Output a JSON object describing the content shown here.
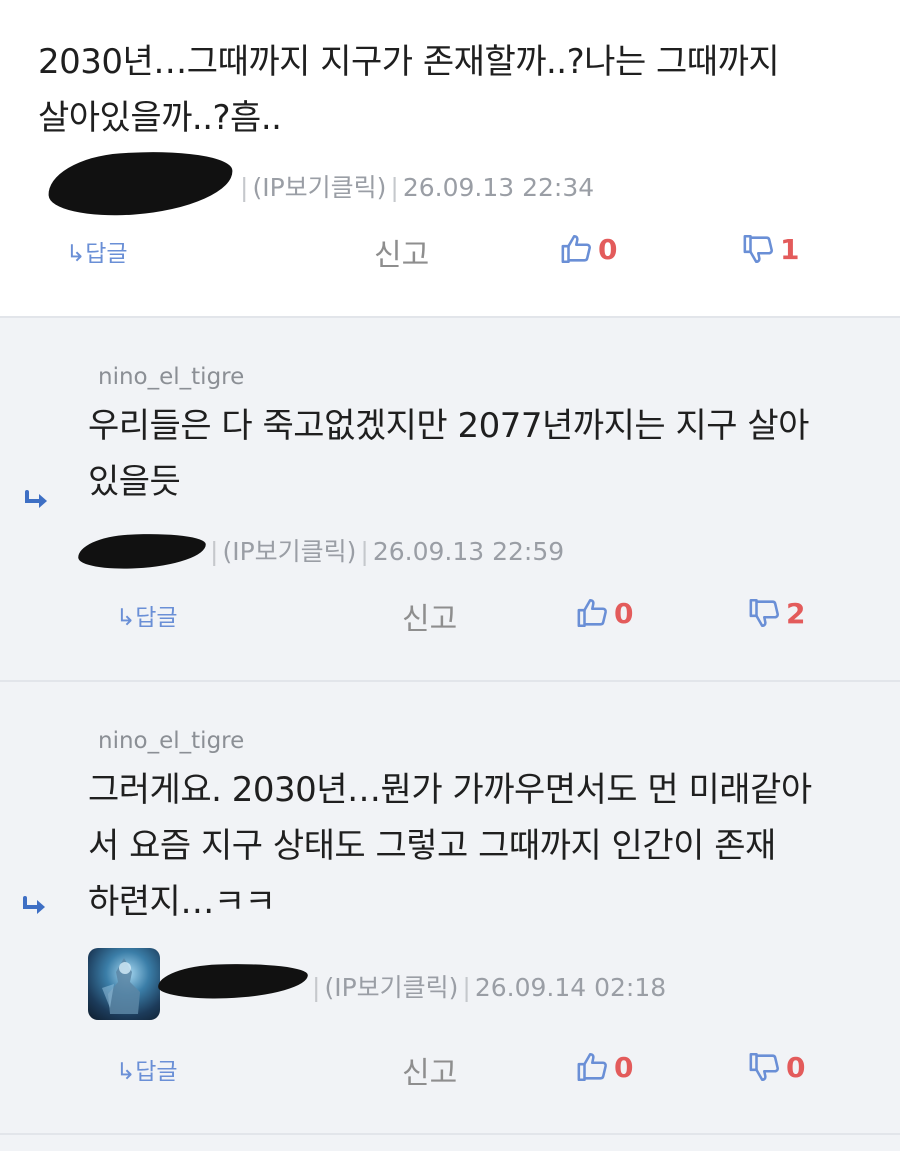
{
  "comments": [
    {
      "text_lines": [
        "2030년…그때까지 지구가 존재할까..?나는 그때까지",
        "살아있을까..?흠.."
      ],
      "ip_label": "(IP보기클릭)",
      "datetime": "26.09.13 22:34",
      "reply_label": "↳답글",
      "report_label": "신고",
      "likes": "0",
      "dislikes": "1"
    },
    {
      "reply_to": "nino_el_tigre",
      "text_lines": [
        "우리들은 다 죽고없겠지만 2077년까지는 지구 살아",
        "있을듯"
      ],
      "ip_label": "(IP보기클릭)",
      "datetime": "26.09.13 22:59",
      "reply_label": "↳답글",
      "report_label": "신고",
      "likes": "0",
      "dislikes": "2"
    },
    {
      "reply_to": "nino_el_tigre",
      "text_lines": [
        "그러게요. 2030년…뭔가 가까우면서도 먼 미래같아",
        "서 요즘 지구 상태도 그렇고 그때까지 인간이 존재",
        "하련지…ㅋㅋ"
      ],
      "ip_label": "(IP보기클릭)",
      "datetime": "26.09.14 02:18",
      "reply_label": "↳답글",
      "report_label": "신고",
      "likes": "0",
      "dislikes": "0"
    }
  ],
  "icons": {
    "reply_arrow": "reply-arrow-icon",
    "like": "thumbs-up-icon",
    "dislike": "thumbs-down-icon"
  },
  "colors": {
    "accent_blue": "#3e6fc4",
    "vote_red": "#e35b5b",
    "reply_bg": "#f1f3f6"
  }
}
